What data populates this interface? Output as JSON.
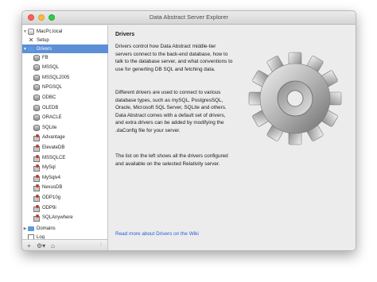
{
  "window": {
    "title": "Data Abstract Server Explorer"
  },
  "sidebar": {
    "server": "MacPc.local",
    "setup": "Setup",
    "drivers_group": "Drivers",
    "drivers": [
      "FB",
      "MSSQL",
      "MSSQL2005",
      "NPGSQL",
      "ODBC",
      "OLEDB",
      "ORACLE",
      "SQLite",
      "Advantage",
      "ElevateDB",
      "MSSQLCE",
      "MySql",
      "MySqlv4",
      "NexusDB",
      "ODP10g",
      "ODP9i",
      "SQLAnywhere"
    ],
    "domains": "Domains",
    "log": "Log"
  },
  "bottombar": {
    "add": "+",
    "settings": "⚙▾",
    "home": "⌂"
  },
  "content": {
    "heading": "Drivers",
    "para1": "Drivers control how Data Abstract middle-tier servers connect to the back-end database, how to talk to the database server, and what conventions to use for generting DB SQL and fetching data.",
    "para2": "Different drivers are used to connect to various database types, such as mySQL, PostgresSQL, Oracle, Microsoft SQL Server, SQLite and others. Data Abstract comes with a default set of drivers, and extra drivers can be added by modifying the .daConfig file for your server.",
    "para3": "The list on the left shows all the drivers configured and available on the selected Relativity server.",
    "link": "Read more about Drivers on the Wiki"
  },
  "colors": {
    "selection": "#5d8fd6",
    "link": "#2a5bd7"
  },
  "icons": {
    "gear": "gear-icon",
    "database": "database-icon",
    "driver": "driver-icon"
  }
}
